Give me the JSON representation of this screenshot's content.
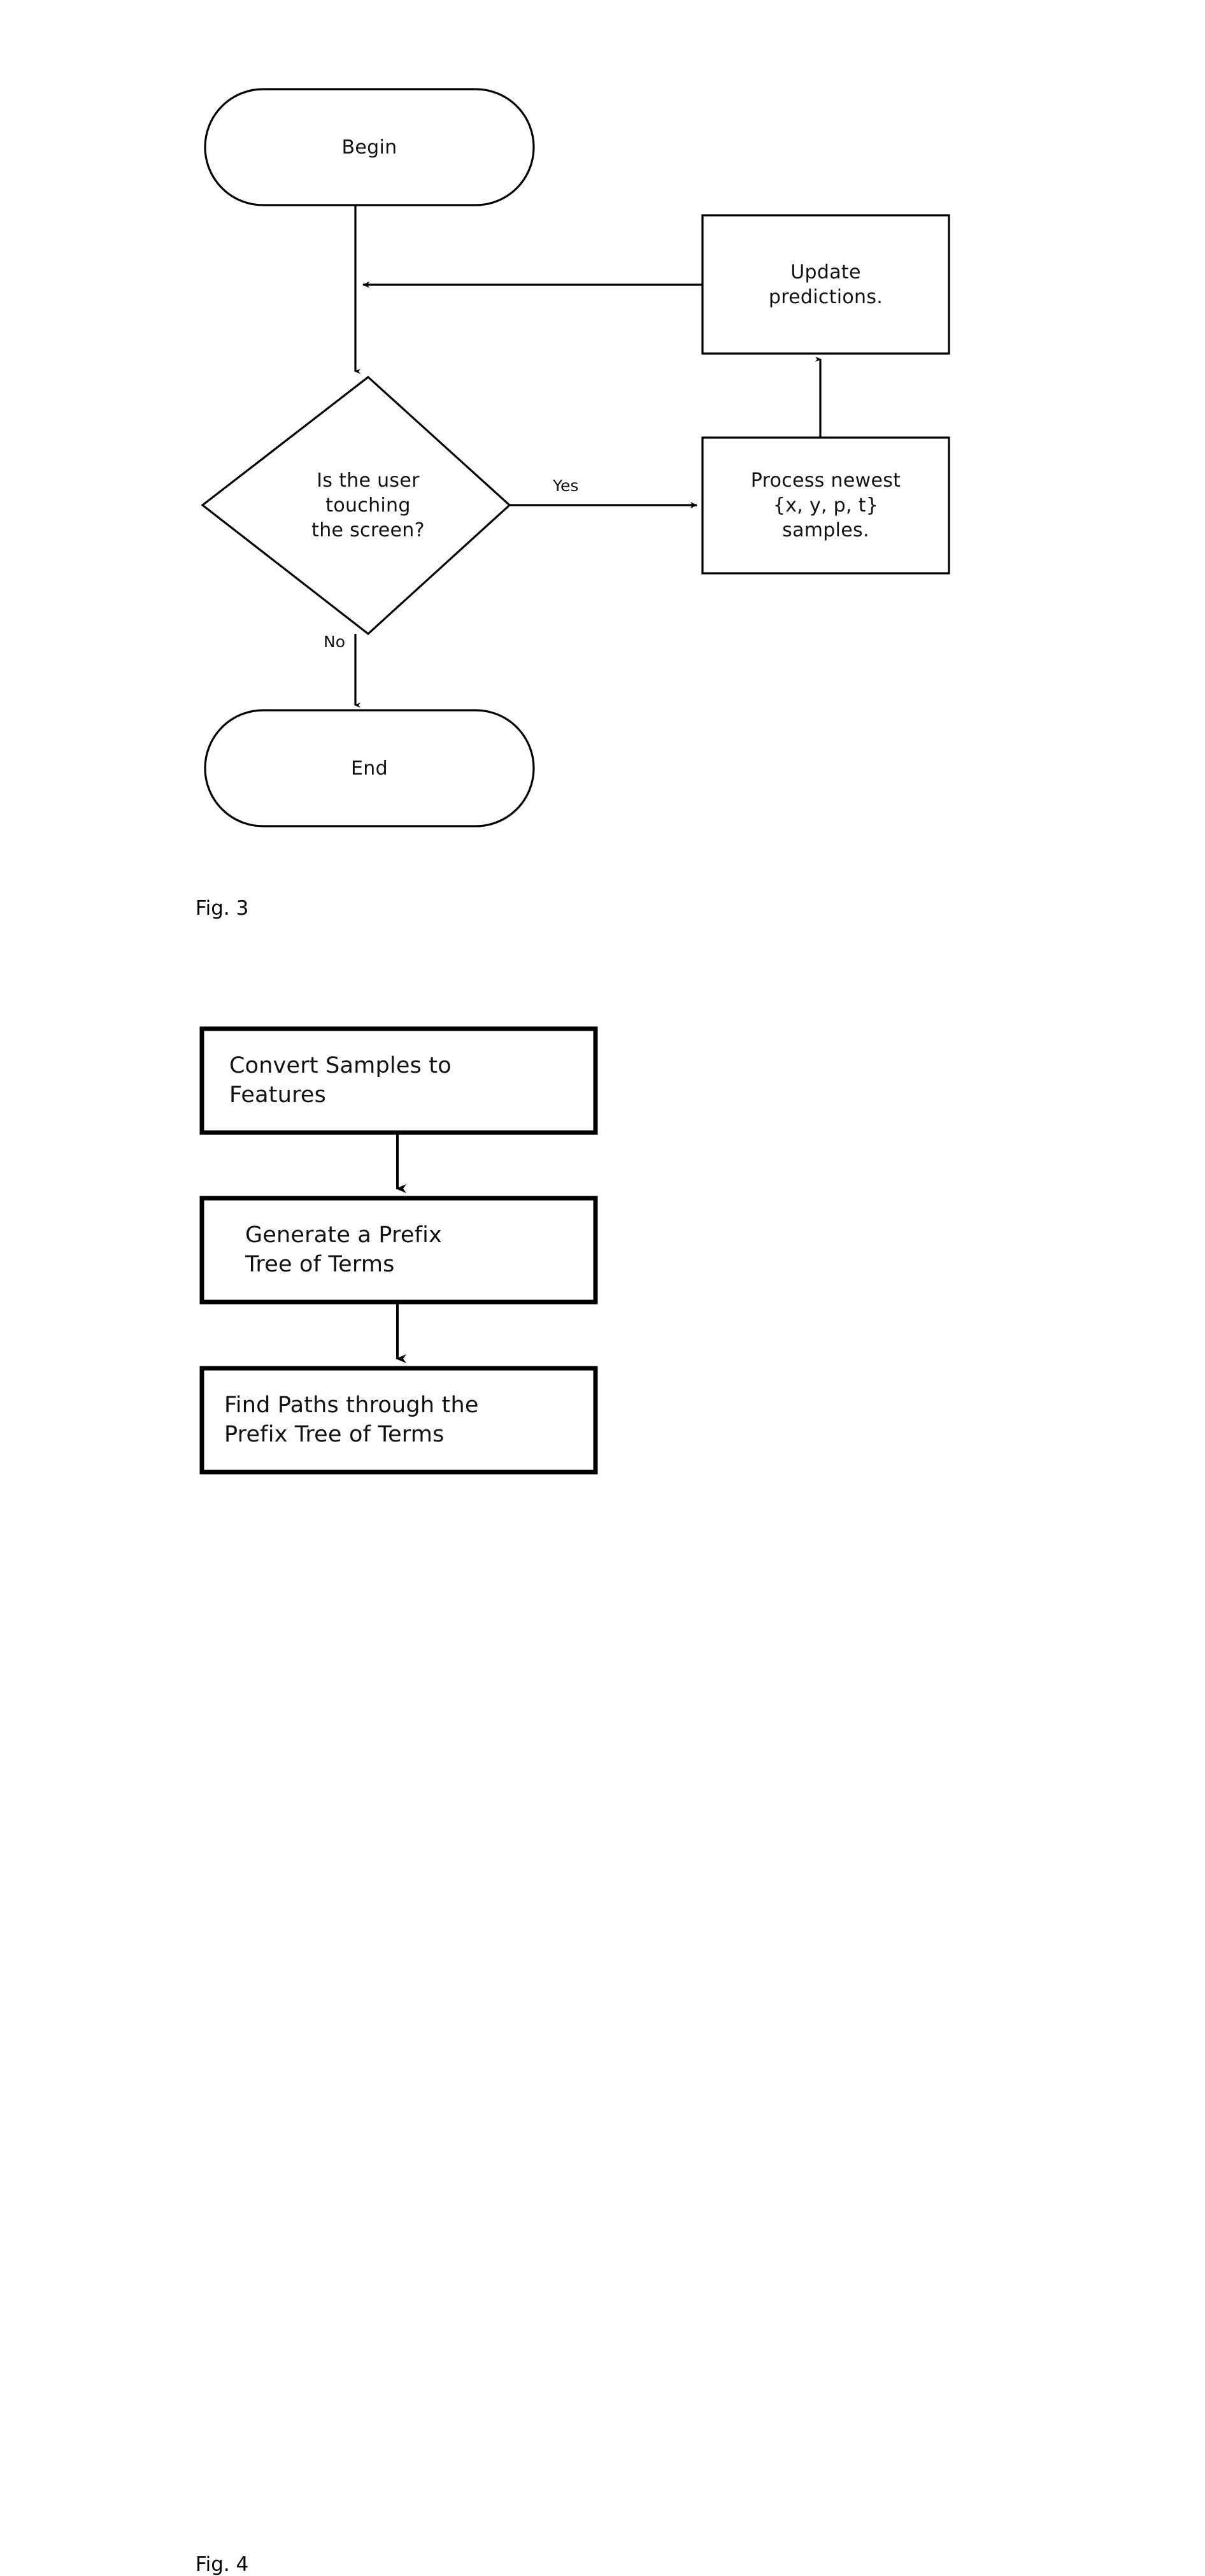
{
  "document": {
    "type": "patent-figure-sheet",
    "background_color": "#ffffff",
    "ink_color": "#000000"
  },
  "figures": [
    {
      "id": "fig3",
      "caption": "Fig. 3",
      "title": "Touch sampling and prediction loop",
      "nodes": [
        {
          "id": "begin",
          "shape": "terminator",
          "text": "Begin"
        },
        {
          "id": "decision",
          "shape": "diamond",
          "text": "Is the user\ntouching\nthe screen?"
        },
        {
          "id": "process",
          "shape": "rectangle",
          "text": "Process newest\n{x, y, p, t}\nsamples."
        },
        {
          "id": "update",
          "shape": "rectangle",
          "text": "Update\npredictions."
        },
        {
          "id": "end",
          "shape": "terminator",
          "text": "End"
        }
      ],
      "edges": [
        {
          "from": "begin",
          "to": "decision",
          "label": ""
        },
        {
          "from": "decision",
          "to": "process",
          "label": "Yes"
        },
        {
          "from": "decision",
          "to": "end",
          "label": "No"
        },
        {
          "from": "process",
          "to": "update",
          "label": ""
        },
        {
          "from": "update",
          "to": "begin",
          "label": ""
        }
      ]
    },
    {
      "id": "fig4",
      "caption": "Fig. 4",
      "title": "Prefix tree term generation sequence",
      "nodes": [
        {
          "id": "convert",
          "shape": "rectangle",
          "text": "Convert Samples to\nFeatures"
        },
        {
          "id": "generate",
          "shape": "rectangle",
          "text": "Generate a Prefix\nTree of Terms"
        },
        {
          "id": "findpath",
          "shape": "rectangle",
          "text": "Find Paths through the\nPrefix Tree of Terms"
        }
      ],
      "edges": [
        {
          "from": "convert",
          "to": "generate",
          "label": ""
        },
        {
          "from": "generate",
          "to": "findpath",
          "label": ""
        }
      ]
    }
  ],
  "fig3": {
    "begin_text": "Begin",
    "decision_text": "Is the user\ntouching\nthe screen?",
    "process_text": "Process newest\n{x, y, p, t}\nsamples.",
    "update_text": "Update\npredictions.",
    "end_text": "End",
    "yes_label": "Yes",
    "no_label": "No",
    "caption": "Fig. 3"
  },
  "fig4": {
    "box1_text": "Convert Samples to\nFeatures",
    "box2_text": "Generate a Prefix\nTree of Terms",
    "box3_text": "Find Paths through the\nPrefix Tree of Terms",
    "caption": "Fig. 4"
  }
}
